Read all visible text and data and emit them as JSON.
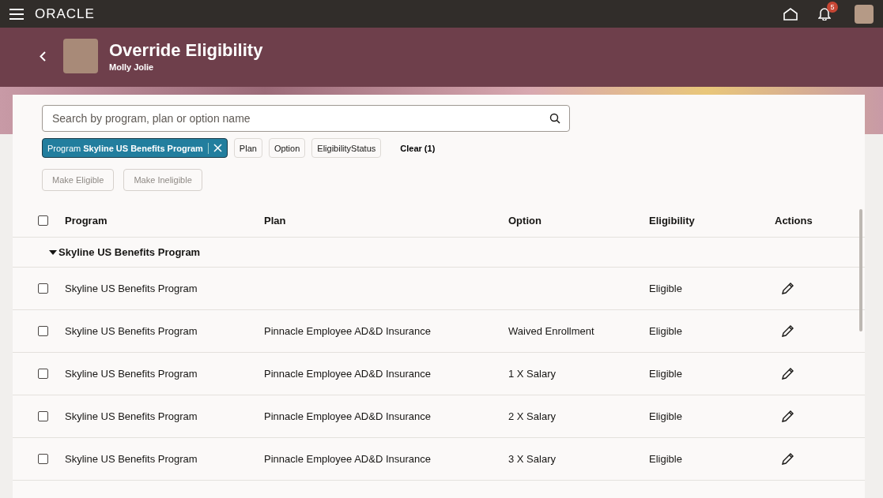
{
  "topbar": {
    "logo": "ORACLE",
    "notification_count": "5"
  },
  "header": {
    "title": "Override Eligibility",
    "subtitle": "Molly Jolie"
  },
  "search": {
    "placeholder": "Search by program, plan or option name"
  },
  "filters": [
    {
      "kind": "applied",
      "label": "Program",
      "value": "Skyline US Benefits Program",
      "selected": true
    },
    {
      "kind": "chip",
      "label": "Plan",
      "selected": false
    },
    {
      "kind": "chip",
      "label": "Option",
      "selected": false
    },
    {
      "kind": "chip",
      "label": "EligibilityStatus",
      "selected": false
    },
    {
      "kind": "clear",
      "label": "Clear (1)",
      "selected": false
    }
  ],
  "actions": [
    {
      "label": "Make Eligible",
      "disabled": true
    },
    {
      "label": "Make Ineligible",
      "disabled": true
    }
  ],
  "table": {
    "select_all_checked": false,
    "columns": [
      "Program",
      "Plan",
      "Option",
      "Eligibility",
      "Actions"
    ],
    "group": {
      "label": "Skyline US Benefits Program",
      "expanded": true
    },
    "rows": [
      {
        "checked": false,
        "program": "Skyline US Benefits Program",
        "plan": "",
        "option": "",
        "eligibility": "Eligible"
      },
      {
        "checked": false,
        "program": "Skyline US Benefits Program",
        "plan": "Pinnacle Employee AD&D Insurance",
        "option": "Waived Enrollment",
        "eligibility": "Eligible"
      },
      {
        "checked": false,
        "program": "Skyline US Benefits Program",
        "plan": "Pinnacle Employee AD&D Insurance",
        "option": "1 X Salary",
        "eligibility": "Eligible"
      },
      {
        "checked": false,
        "program": "Skyline US Benefits Program",
        "plan": "Pinnacle Employee AD&D Insurance",
        "option": "2 X Salary",
        "eligibility": "Eligible"
      },
      {
        "checked": false,
        "program": "Skyline US Benefits Program",
        "plan": "Pinnacle Employee AD&D Insurance",
        "option": "3 X Salary",
        "eligibility": "Eligible"
      }
    ]
  }
}
